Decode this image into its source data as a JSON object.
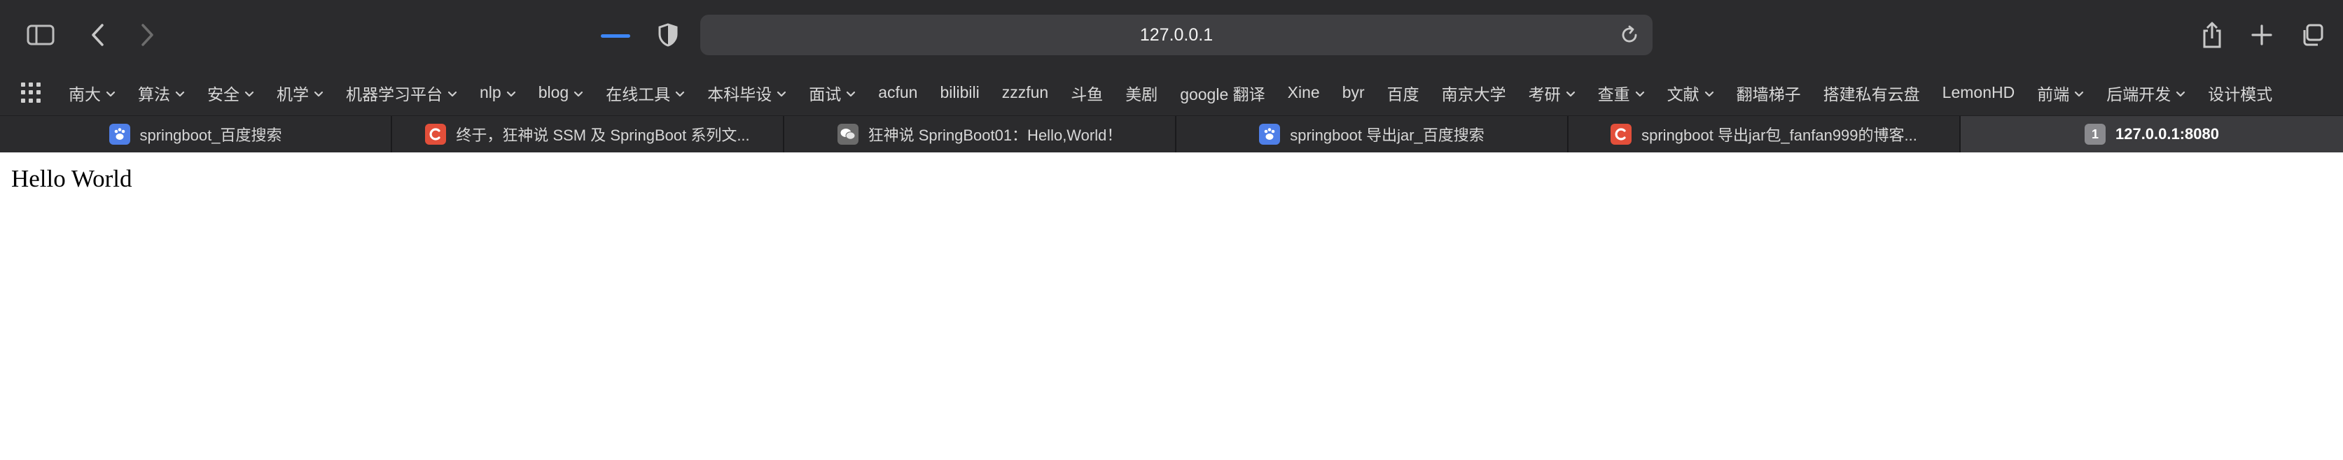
{
  "toolbar": {
    "url": "127.0.0.1",
    "icons": [
      "sidebar-icon",
      "back-arrow-icon",
      "forward-arrow-icon",
      "privacy-shield-icon",
      "reload-icon",
      "share-icon",
      "new-tab-plus-icon",
      "tab-overview-icon"
    ]
  },
  "bookmarks": [
    {
      "label": "南大",
      "folder": true
    },
    {
      "label": "算法",
      "folder": true
    },
    {
      "label": "安全",
      "folder": true
    },
    {
      "label": "机学",
      "folder": true
    },
    {
      "label": "机器学习平台",
      "folder": true
    },
    {
      "label": "nlp",
      "folder": true
    },
    {
      "label": "blog",
      "folder": true
    },
    {
      "label": "在线工具",
      "folder": true
    },
    {
      "label": "本科毕设",
      "folder": true
    },
    {
      "label": "面试",
      "folder": true
    },
    {
      "label": "acfun",
      "folder": false
    },
    {
      "label": "bilibili",
      "folder": false
    },
    {
      "label": "zzzfun",
      "folder": false
    },
    {
      "label": "斗鱼",
      "folder": false
    },
    {
      "label": "美剧",
      "folder": false
    },
    {
      "label": "google 翻译",
      "folder": false
    },
    {
      "label": "Xine",
      "folder": false
    },
    {
      "label": "byr",
      "folder": false
    },
    {
      "label": "百度",
      "folder": false
    },
    {
      "label": "南京大学",
      "folder": false
    },
    {
      "label": "考研",
      "folder": true
    },
    {
      "label": "查重",
      "folder": true
    },
    {
      "label": "文献",
      "folder": true
    },
    {
      "label": "翻墙梯子",
      "folder": false
    },
    {
      "label": "搭建私有云盘",
      "folder": false
    },
    {
      "label": "LemonHD",
      "folder": false
    },
    {
      "label": "前端",
      "folder": true
    },
    {
      "label": "后端开发",
      "folder": true
    },
    {
      "label": "设计模式",
      "folder": false
    }
  ],
  "tabs": [
    {
      "title": "springboot_百度搜索",
      "favicon": "baidu-paw-icon"
    },
    {
      "title": "终于，狂神说 SSM 及 SpringBoot 系列文...",
      "favicon": "csdn-c-icon"
    },
    {
      "title": "狂神说 SpringBoot01：Hello,World！",
      "favicon": "wechat-icon"
    },
    {
      "title": "springboot 导出jar_百度搜索",
      "favicon": "baidu-paw-icon"
    },
    {
      "title": "springboot 导出jar包_fanfan999的博客...",
      "favicon": "csdn-c-icon"
    },
    {
      "title": "127.0.0.1:8080",
      "favicon_text": "1",
      "active": true
    }
  ],
  "page": {
    "body_text": "Hello World"
  },
  "colors": {
    "chrome_bg": "#2b2b2d",
    "url_bg": "#3f3f42",
    "active_tab_bg": "#3b3b3e",
    "loading_accent": "#3d86f5",
    "baidu_blue": "#4f7fe8",
    "csdn_red": "#e34f3a"
  }
}
